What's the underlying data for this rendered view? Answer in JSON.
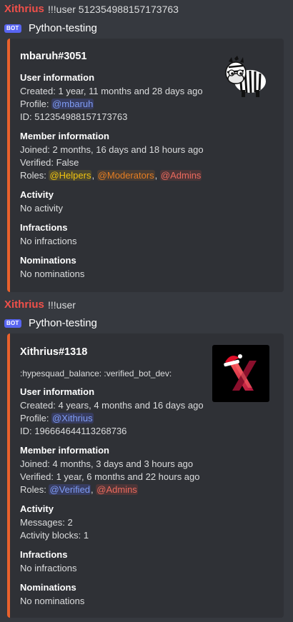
{
  "message1": {
    "author": "Xithrius",
    "command": "!!!user 512354988157173763"
  },
  "bot1": {
    "badge": "BOT",
    "name": "Python-testing"
  },
  "embed1": {
    "title": "mbaruh#3051",
    "user_info_name": "User information",
    "created": "Created: 1 year, 11 months and 28 days ago",
    "profile_label": "Profile: ",
    "profile_mention": "@mbaruh",
    "id": "ID: 512354988157173763",
    "member_info_name": "Member information",
    "joined": "Joined: 2 months, 16 days and 18 hours ago",
    "verified": "Verified: False",
    "roles_label": "Roles: ",
    "roles": [
      "@Helpers",
      "@Moderators",
      "@Admins"
    ],
    "sep": ", ",
    "activity_name": "Activity",
    "activity_value": "No activity",
    "infractions_name": "Infractions",
    "infractions_value": "No infractions",
    "nominations_name": "Nominations",
    "nominations_value": "No nominations",
    "thumbnail": "zebra-avatar",
    "accent": "#e8612c"
  },
  "message2": {
    "author": "Xithrius",
    "command": "!!!user"
  },
  "bot2": {
    "badge": "BOT",
    "name": "Python-testing"
  },
  "embed2": {
    "title": "Xithrius#1318",
    "badges": ":hypesquad_balance: :verified_bot_dev:",
    "user_info_name": "User information",
    "created": "Created: 4 years, 4 months and 16 days ago",
    "profile_label": "Profile: ",
    "profile_mention": "@Xithrius",
    "id": "ID: 196664644113268736",
    "member_info_name": "Member information",
    "joined": "Joined: 4 months, 3 days and 3 hours ago",
    "verified": "Verified: 1 year, 6 months and 22 hours ago",
    "roles_label": "Roles: ",
    "roles": [
      "@Verified",
      "@Admins"
    ],
    "sep": ", ",
    "activity_name": "Activity",
    "messages": "Messages: 2",
    "activity_blocks": "Activity blocks: 1",
    "infractions_name": "Infractions",
    "infractions_value": "No infractions",
    "nominations_name": "Nominations",
    "nominations_value": "No nominations",
    "thumbnail": "x-logo-avatar",
    "logo_letter": "X",
    "accent": "#e8612c"
  },
  "colors": {
    "background": "#36393f",
    "embed_bg": "#2f3136",
    "username": "#f0504a",
    "bot_badge": "#5865f2"
  }
}
